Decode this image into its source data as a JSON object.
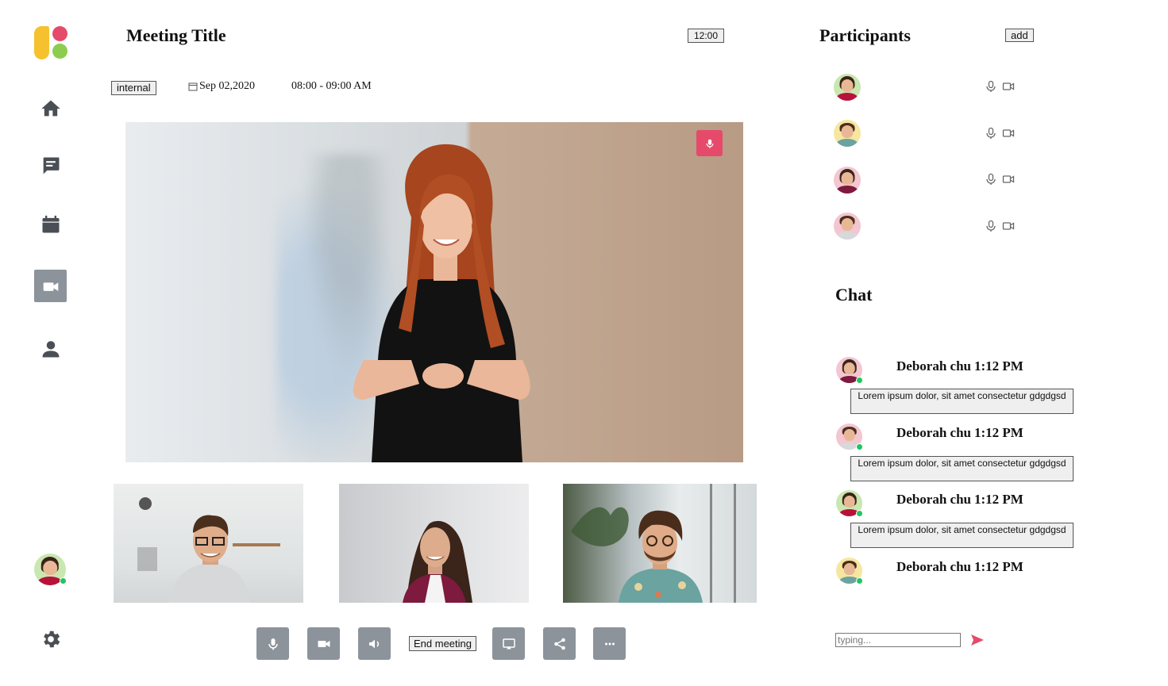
{
  "header": {
    "title": "Meeting Title",
    "clock": "12:00",
    "tag": "internal",
    "date": "Sep 02,2020",
    "time_range": "08:00 - 09:00 AM"
  },
  "sidebar": {
    "items": [
      {
        "icon": "home-icon"
      },
      {
        "icon": "chat-icon"
      },
      {
        "icon": "calendar-icon"
      },
      {
        "icon": "video-icon",
        "active": true
      },
      {
        "icon": "user-icon"
      }
    ],
    "settings_icon": "gear-icon"
  },
  "controls": {
    "end_meeting_label": "End meeting"
  },
  "participants": {
    "title": "Participants",
    "add_label": "add",
    "count": 4
  },
  "chat": {
    "title": "Chat",
    "messages": [
      {
        "author": "Deborah chu",
        "time": "1:12 PM",
        "text": "Lorem ipsum dolor, sit amet consectetur gdgdgsd"
      },
      {
        "author": "Deborah chu",
        "time": "1:12 PM",
        "text": "Lorem ipsum dolor, sit amet consectetur gdgdgsd"
      },
      {
        "author": "Deborah chu",
        "time": "1:12 PM",
        "text": "Lorem ipsum dolor, sit amet consectetur gdgdgsd"
      },
      {
        "author": "Deborah chu",
        "time": "1:12 PM"
      }
    ],
    "input_placeholder": "typing..."
  },
  "colors": {
    "accent": "#e64a6b",
    "icon_gray": "#4a4f55",
    "active_bg": "#8d939a",
    "online": "#22c55e"
  }
}
